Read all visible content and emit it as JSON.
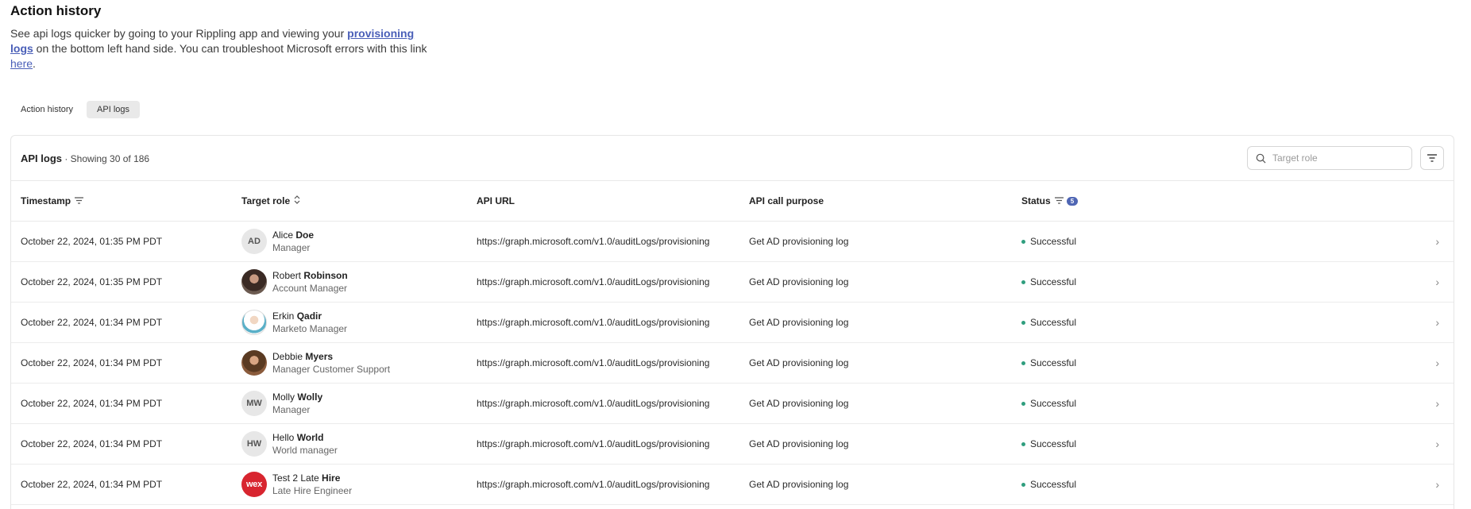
{
  "header": {
    "title": "Action history",
    "desc_part1": "See api logs quicker by going to your Rippling app and viewing your ",
    "link_provisioning": "provisioning",
    "link_logs": "logs",
    "desc_part2": " on the bottom left hand side. You can troubleshoot Microsoft errors with this link ",
    "link_here": "here",
    "desc_end": "."
  },
  "subtabs": [
    {
      "label": "Action history",
      "active": false
    },
    {
      "label": "API logs",
      "active": true
    }
  ],
  "panel": {
    "title": "API logs",
    "subtitle": " · Showing 30 of 186",
    "search_placeholder": "Target role"
  },
  "columns": {
    "timestamp": "Timestamp",
    "target_role": "Target role",
    "api_url": "API URL",
    "purpose": "API call purpose",
    "status": "Status",
    "status_badge": "5"
  },
  "rows": [
    {
      "timestamp": "October 22, 2024, 01:35 PM PDT",
      "first": "Alice ",
      "last": "Doe",
      "title": "Manager",
      "avatar": "AD",
      "avatar_type": "initials",
      "url": "https://graph.microsoft.com/v1.0/auditLogs/provisioning",
      "purpose": "Get AD provisioning log",
      "status": "Successful"
    },
    {
      "timestamp": "October 22, 2024, 01:35 PM PDT",
      "first": "Robert ",
      "last": "Robinson",
      "title": "Account Manager",
      "avatar": "",
      "avatar_type": "photo1",
      "url": "https://graph.microsoft.com/v1.0/auditLogs/provisioning",
      "purpose": "Get AD provisioning log",
      "status": "Successful"
    },
    {
      "timestamp": "October 22, 2024, 01:34 PM PDT",
      "first": "Erkin ",
      "last": "Qadir",
      "title": "Marketo Manager",
      "avatar": "",
      "avatar_type": "photo2",
      "url": "https://graph.microsoft.com/v1.0/auditLogs/provisioning",
      "purpose": "Get AD provisioning log",
      "status": "Successful"
    },
    {
      "timestamp": "October 22, 2024, 01:34 PM PDT",
      "first": "Debbie ",
      "last": "Myers",
      "title": "Manager Customer Support",
      "avatar": "",
      "avatar_type": "photo3",
      "url": "https://graph.microsoft.com/v1.0/auditLogs/provisioning",
      "purpose": "Get AD provisioning log",
      "status": "Successful"
    },
    {
      "timestamp": "October 22, 2024, 01:34 PM PDT",
      "first": "Molly ",
      "last": "Wolly",
      "title": "Manager",
      "avatar": "MW",
      "avatar_type": "initials",
      "url": "https://graph.microsoft.com/v1.0/auditLogs/provisioning",
      "purpose": "Get AD provisioning log",
      "status": "Successful"
    },
    {
      "timestamp": "October 22, 2024, 01:34 PM PDT",
      "first": "Hello ",
      "last": "World",
      "title": "World manager",
      "avatar": "HW",
      "avatar_type": "initials",
      "url": "https://graph.microsoft.com/v1.0/auditLogs/provisioning",
      "purpose": "Get AD provisioning log",
      "status": "Successful"
    },
    {
      "timestamp": "October 22, 2024, 01:34 PM PDT",
      "first": "Test 2 Late ",
      "last": "Hire",
      "title": "Late Hire Engineer",
      "avatar": "wex",
      "avatar_type": "wex",
      "url": "https://graph.microsoft.com/v1.0/auditLogs/provisioning",
      "purpose": "Get AD provisioning log",
      "status": "Successful"
    }
  ],
  "colors": {
    "accent": "#4a5fb8",
    "badge": "#4f66b4",
    "success": "#2f9e7e",
    "brand_logo": "#d8252f"
  },
  "icons": {
    "search": "search-icon",
    "filter": "filter-icon",
    "sort": "sort-icon",
    "chevron": "chevron-right-icon"
  }
}
